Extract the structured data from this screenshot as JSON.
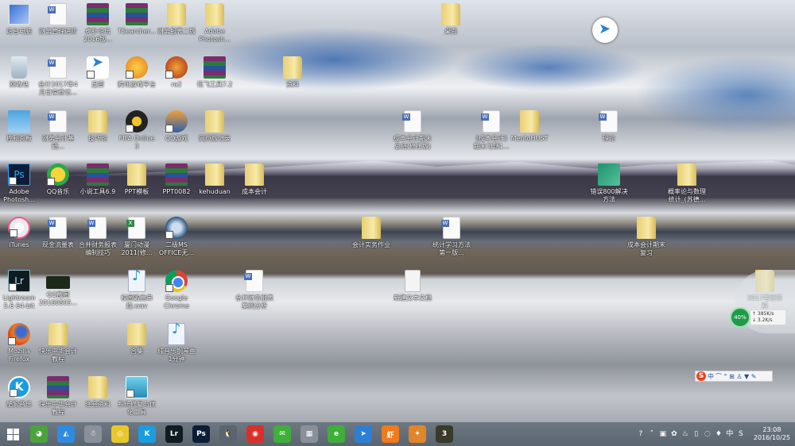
{
  "desktop_icons": [
    {
      "label": "这台电脑",
      "type": "pc"
    },
    {
      "label": "财务管理进阶",
      "type": "doc"
    },
    {
      "label": "虎扑论坛2016版...",
      "type": "rar"
    },
    {
      "label": "TSearcher...",
      "type": "rar"
    },
    {
      "label": "财务报表二版",
      "type": "folder"
    },
    {
      "label": "Adobe Photosh...",
      "type": "folder"
    },
    {
      "label": "桌面",
      "type": "folder"
    },
    {
      "label": "回收站",
      "type": "bin"
    },
    {
      "label": "会计2017年4月日常登记...",
      "type": "doc"
    },
    {
      "label": "迅雷",
      "type": "bird"
    },
    {
      "label": "腾讯游戏平台",
      "type": "game"
    },
    {
      "label": "ra2",
      "type": "ra2"
    },
    {
      "label": "讯飞工具7.2",
      "type": "rar"
    },
    {
      "label": "资料",
      "type": "folder"
    },
    {
      "label": "控制面板",
      "type": "panel"
    },
    {
      "label": "财务会计基础...",
      "type": "doc"
    },
    {
      "label": "技巧论",
      "type": "folder"
    },
    {
      "label": "FIFA Online 3",
      "type": "fifa"
    },
    {
      "label": "QQ游戏",
      "type": "qqgame"
    },
    {
      "label": "网页版记录",
      "type": "folder"
    },
    {
      "label": "成本会计期末总结(修正版)",
      "type": "doc"
    },
    {
      "label": "《成本会计》期末习题1...",
      "type": "doc"
    },
    {
      "label": "MentoHUST",
      "type": "folder"
    },
    {
      "label": "理论",
      "type": "doc"
    },
    {
      "label": "Adobe Photosh...",
      "type": "ps"
    },
    {
      "label": "QQ音乐",
      "type": "qqmusic"
    },
    {
      "label": "小说工具6.9",
      "type": "rar"
    },
    {
      "label": "PPT模板",
      "type": "folder"
    },
    {
      "label": "PPT0082",
      "type": "rar"
    },
    {
      "label": "kehuduan",
      "type": "folder"
    },
    {
      "label": "成本会计",
      "type": "folder"
    },
    {
      "label": "错误800解决方法",
      "type": "app"
    },
    {
      "label": "概率论与数理统计_(苏德...",
      "type": "folder"
    },
    {
      "label": "iTunes",
      "type": "itunes"
    },
    {
      "label": "现金流量表",
      "type": "doc"
    },
    {
      "label": "合并财务报表编制技巧",
      "type": "doc"
    },
    {
      "label": "厦门动漫2011(修...",
      "type": "xls"
    },
    {
      "label": "二级MS OFFICE无...",
      "type": "app2"
    },
    {
      "label": "会计实务作业",
      "type": "folder"
    },
    {
      "label": "统计学习方法第一版...",
      "type": "doc"
    },
    {
      "label": "成本会计期末复习",
      "type": "folder"
    },
    {
      "label": "Lightroom 5.6 64-bit",
      "type": "lr"
    },
    {
      "label": "QQ截图20160805...",
      "type": "img"
    },
    {
      "label": "校园歌曲串烧.wav",
      "type": "audio"
    },
    {
      "label": "Google Chrome",
      "type": "chrome"
    },
    {
      "label": "合并财务报表案例分析",
      "type": "doc"
    },
    {
      "label": "新建文本文档",
      "type": "txt"
    },
    {
      "label": "2017考研资料",
      "type": "folder"
    },
    {
      "label": "Mozilla Firefox",
      "type": "ff"
    },
    {
      "label": "快乐中华会计教程",
      "type": "folder"
    },
    {
      "label": "合集",
      "type": "folder"
    },
    {
      "label": "纯音乐钢琴曲1分钟",
      "type": "audio"
    },
    {
      "label": "酷狗音乐",
      "type": "kugou"
    },
    {
      "label": "快乐中华会计教程",
      "type": "rar"
    },
    {
      "label": "注会资料",
      "type": "folder"
    },
    {
      "label": "系统修复与优化工具",
      "type": "app3"
    }
  ],
  "net_widget": {
    "percent": "40%",
    "up": "↑ 385K/s",
    "down": "↓ 3.2K/s"
  },
  "sogou_bar": {
    "logo": "S",
    "mode": "中",
    "icons": "⌒ ° ⊞ ♙ ▼ ✎"
  },
  "taskbar": {
    "apps": [
      {
        "name": "360-browser",
        "glyph": "◕",
        "color": "#4aa33b"
      },
      {
        "name": "baidu-netdisk",
        "glyph": "◭",
        "color": "#2f8be0"
      },
      {
        "name": "qq-pet",
        "glyph": "☃",
        "color": "#8a9099"
      },
      {
        "name": "qq-music",
        "glyph": "◎",
        "color": "#e8c72a"
      },
      {
        "name": "kugou",
        "glyph": "K",
        "color": "#1a9de0"
      },
      {
        "name": "lightroom",
        "glyph": "Lr",
        "color": "#0e1c22"
      },
      {
        "name": "photoshop",
        "glyph": "Ps",
        "color": "#0d1d35"
      },
      {
        "name": "qq",
        "glyph": "🐧",
        "color": "#5b6570"
      },
      {
        "name": "netease-music",
        "glyph": "◉",
        "color": "#d9302a"
      },
      {
        "name": "wechat",
        "glyph": "✉",
        "color": "#3fae3a"
      },
      {
        "name": "mail",
        "glyph": "▦",
        "color": "#8a9099"
      },
      {
        "name": "ie-360",
        "glyph": "e",
        "color": "#3fae3a"
      },
      {
        "name": "xunlei",
        "glyph": "➤",
        "color": "#2d7fd5"
      },
      {
        "name": "xiami",
        "glyph": "虾",
        "color": "#f07a1c"
      },
      {
        "name": "tencent-game",
        "glyph": "✦",
        "color": "#e0852a"
      },
      {
        "name": "fifa",
        "glyph": "3",
        "color": "#3a3a2a"
      }
    ],
    "tray": [
      "?",
      "˄",
      "▣",
      "✿",
      "♨",
      "▯",
      "◌",
      "♦",
      "中",
      "S"
    ],
    "time": "23:08",
    "date": "2016/10/25"
  }
}
